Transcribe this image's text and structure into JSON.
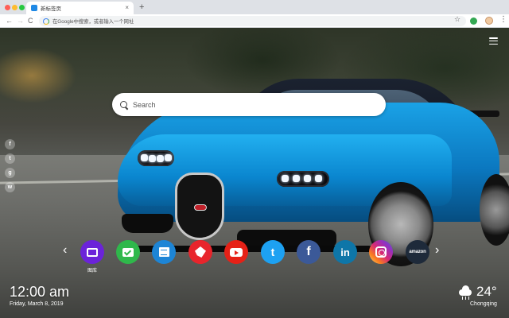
{
  "browser": {
    "tab_title": "新标签页",
    "tab_close": "×",
    "new_tab": "+",
    "address_placeholder": "在Google中搜索，或者输入一个网址",
    "nav": {
      "back": "←",
      "forward": "→",
      "reload": "C"
    },
    "star": "☆",
    "menu": "⋮"
  },
  "page": {
    "search_placeholder": "Search",
    "social_icons": [
      "facebook-icon",
      "twitter-icon",
      "google-plus-icon",
      "wechat-icon"
    ],
    "social_glyphs": [
      "f",
      "t",
      "g",
      "w"
    ],
    "arrows": {
      "left": "‹",
      "right": "›"
    },
    "shortcuts": [
      {
        "name": "gallery",
        "label": "图库",
        "color": "#6b23d9",
        "icon": "image-icon"
      },
      {
        "name": "tasks",
        "label": "",
        "color": "#2fb84b",
        "icon": "check-icon"
      },
      {
        "name": "notes",
        "label": "",
        "color": "#1d85d6",
        "icon": "note-icon"
      },
      {
        "name": "games",
        "label": "",
        "color": "#e8252c",
        "icon": "game-icon"
      },
      {
        "name": "youtube",
        "label": "",
        "color": "#e62117",
        "icon": "youtube-icon"
      },
      {
        "name": "twitter",
        "label": "",
        "color": "#1da1f2",
        "icon": "twitter-icon",
        "glyph": "t"
      },
      {
        "name": "facebook",
        "label": "",
        "color": "#3b5998",
        "icon": "facebook-icon",
        "glyph": "f"
      },
      {
        "name": "linkedin",
        "label": "",
        "color": "#0e76a8",
        "icon": "linkedin-icon",
        "glyph": "in"
      },
      {
        "name": "instagram",
        "label": "",
        "color": "#d62976",
        "icon": "instagram-icon"
      },
      {
        "name": "amazon",
        "label": "",
        "color": "#1e2a3a",
        "icon": "amazon-icon",
        "glyph": "amazon"
      }
    ],
    "clock": {
      "time": "12:00 am",
      "date": "Friday, March 8, 2019"
    },
    "weather": {
      "temp": "24°",
      "city": "Chongqing",
      "icon": "rain-cloud-icon"
    }
  }
}
